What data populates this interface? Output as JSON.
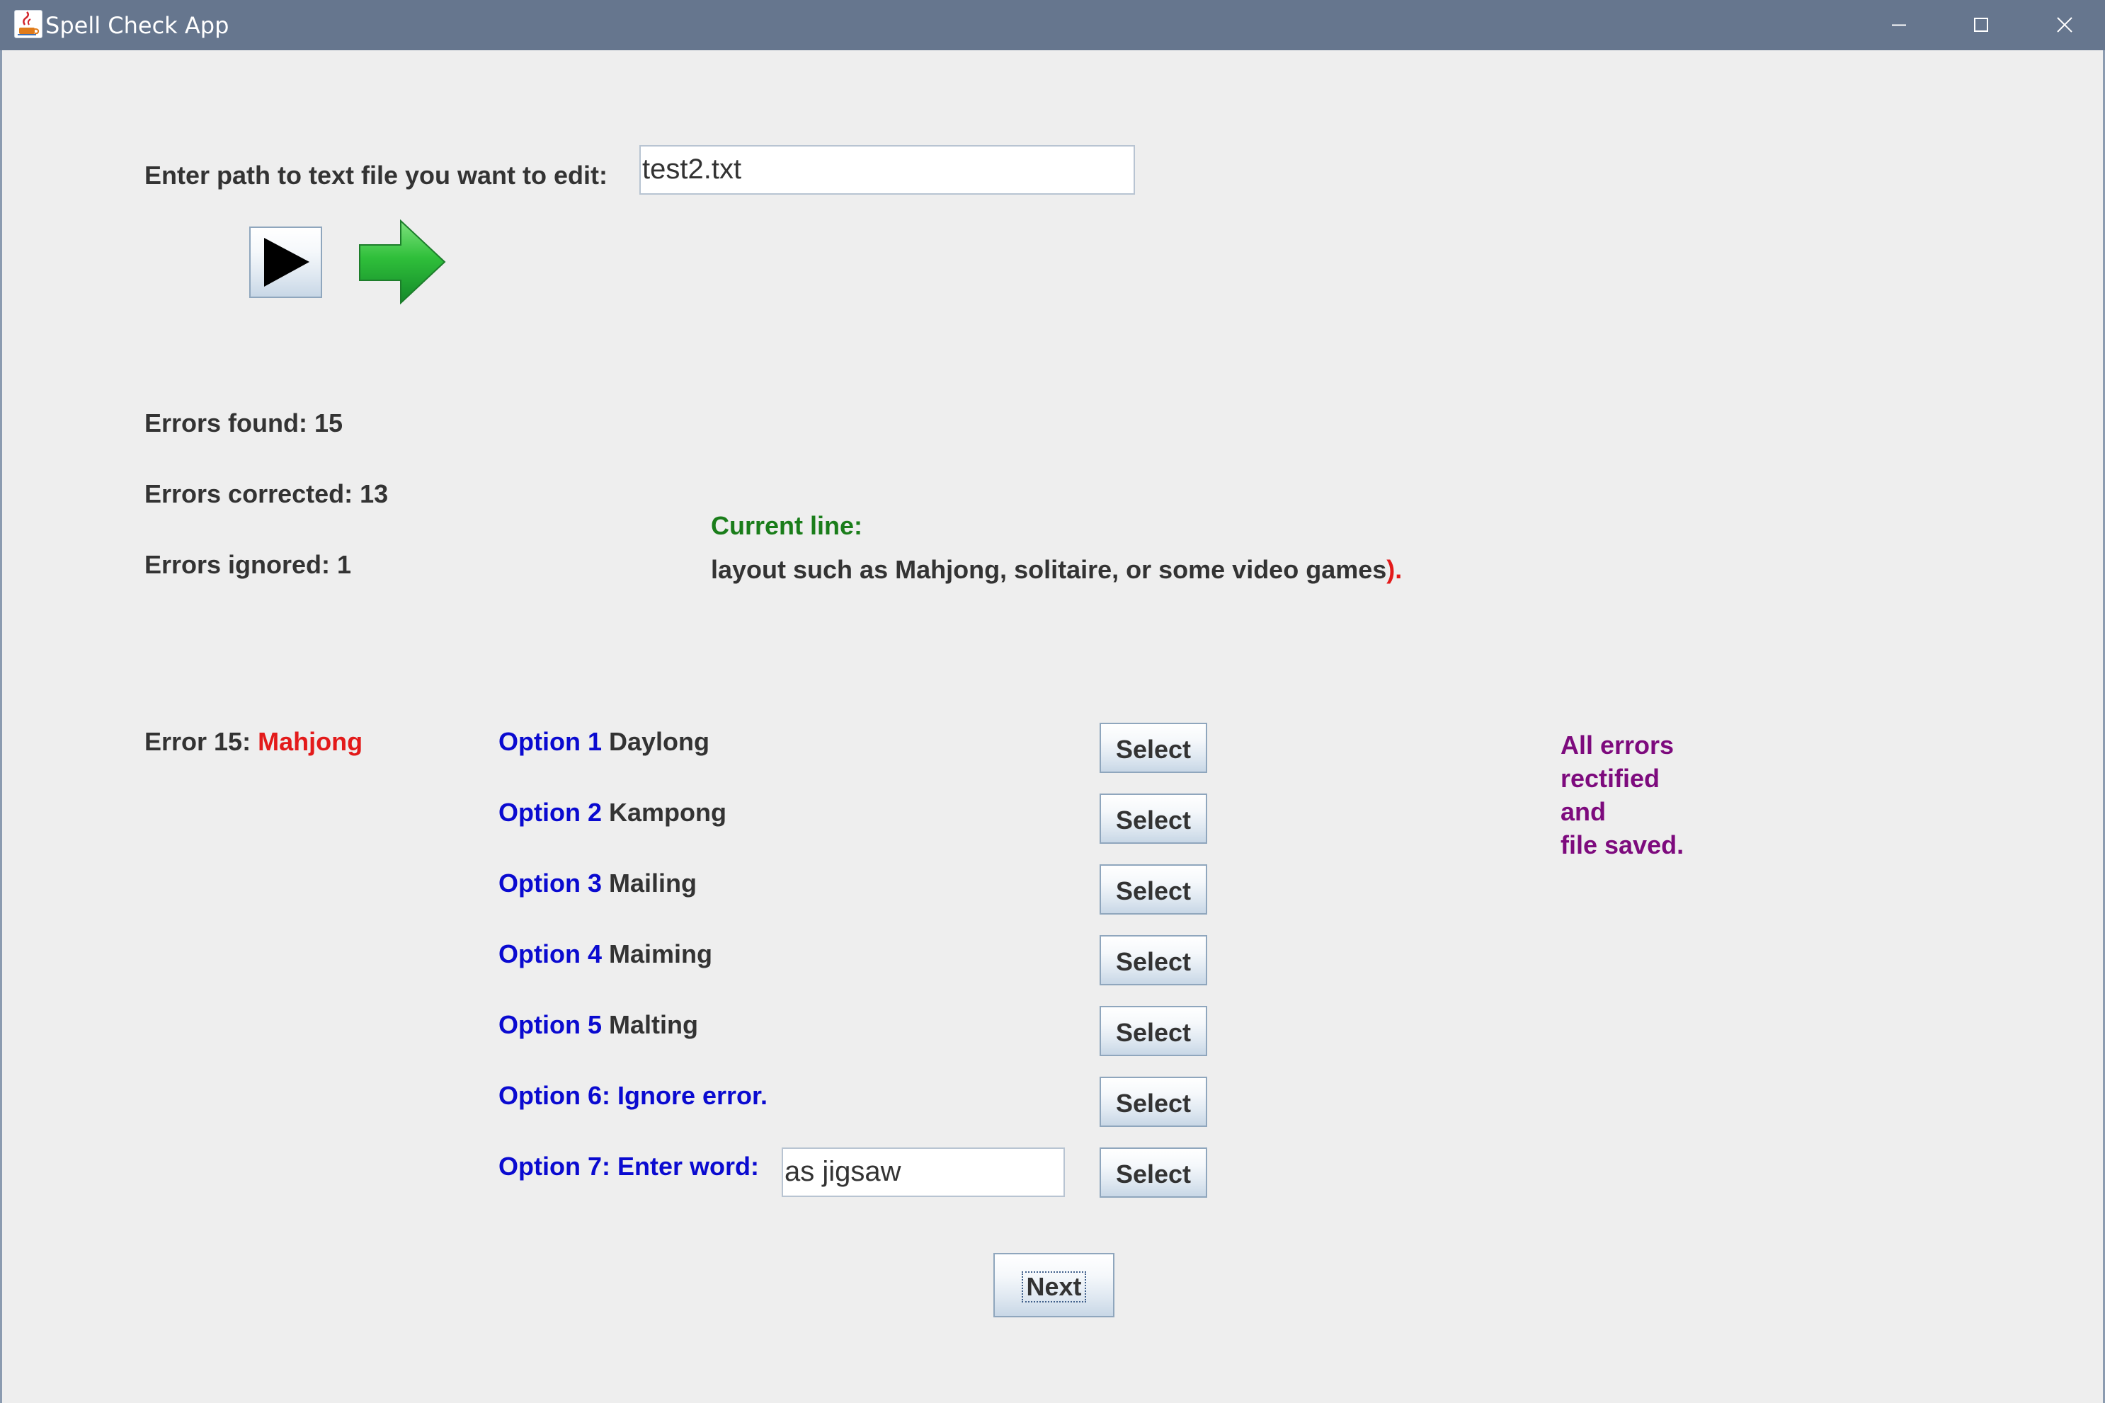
{
  "window": {
    "title": "Spell Check App",
    "controls": [
      "minimize-icon",
      "maximize-icon",
      "close-icon"
    ]
  },
  "file": {
    "label": "Enter path to text file you want to edit:",
    "path_value": "test2.txt"
  },
  "toolbar": {
    "icons": [
      "play-icon",
      "next-arrow-icon"
    ]
  },
  "stats": {
    "found": "Errors found: 15",
    "corrected": "Errors corrected: 13",
    "ignored": "Errors ignored: 1"
  },
  "current_line": {
    "label": "Current line:",
    "text": "layout such as Mahjong, solitaire, or some video games",
    "trailing": ")."
  },
  "error": {
    "label": "Error 15:",
    "word": "Mahjong"
  },
  "options": [
    {
      "label": "Option 1",
      "suggestion": "Daylong",
      "button": "Select"
    },
    {
      "label": "Option 2",
      "suggestion": "Kampong",
      "button": "Select"
    },
    {
      "label": "Option 3",
      "suggestion": "Mailing",
      "button": "Select"
    },
    {
      "label": "Option 4",
      "suggestion": "Maiming",
      "button": "Select"
    },
    {
      "label": "Option 5",
      "suggestion": "Malting",
      "button": "Select"
    },
    {
      "label": "Option 6: Ignore error.",
      "button": "Select"
    },
    {
      "label": "Option 7: Enter word:",
      "input_value": "as jigsaw",
      "button": "Select"
    }
  ],
  "status": {
    "lines": [
      "All errors",
      "rectified",
      "and",
      "file saved."
    ]
  },
  "next_button": "Next",
  "colors": {
    "titlebar": "#66768e",
    "option_blue": "#0a0ad0",
    "error_red": "#e31a1a",
    "current_line_green": "#1a7d1a",
    "status_purple": "#7d0a7d",
    "text_dark": "#333333",
    "background": "#eeeeee"
  }
}
